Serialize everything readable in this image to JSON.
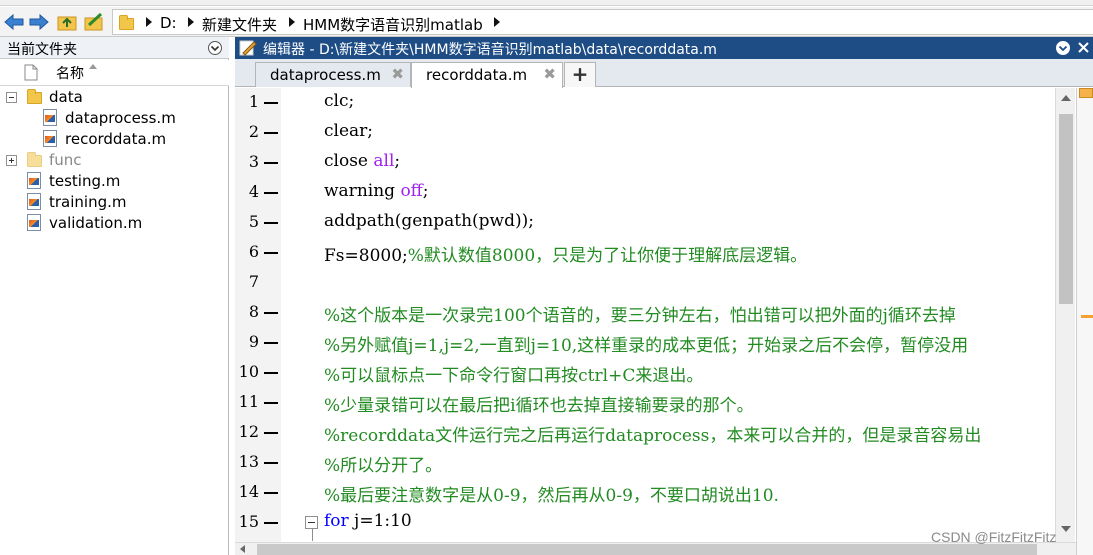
{
  "nav": {
    "back_icon": "arrow-left-icon",
    "forward_icon": "arrow-right-icon",
    "up_icon": "folder-up-icon",
    "browse_icon": "browse-folder-icon"
  },
  "address": {
    "crumbs": [
      "D:",
      "新建文件夹",
      "HMM数字语音识别matlab"
    ]
  },
  "left_panel": {
    "title": "当前文件夹",
    "column_name": "名称",
    "tree": [
      {
        "label": "data",
        "type": "folder",
        "expanded": true
      },
      {
        "label": "dataprocess.m",
        "type": "file"
      },
      {
        "label": "recorddata.m",
        "type": "file"
      },
      {
        "label": "func",
        "type": "folder",
        "expanded": false
      },
      {
        "label": "testing.m",
        "type": "file"
      },
      {
        "label": "training.m",
        "type": "file"
      },
      {
        "label": "validation.m",
        "type": "file"
      }
    ]
  },
  "editor": {
    "title": "编辑器 - D:\\新建文件夹\\HMM数字语音识别matlab\\data\\recorddata.m",
    "tabs": [
      {
        "label": "dataprocess.m",
        "active": false
      },
      {
        "label": "recorddata.m",
        "active": true
      }
    ],
    "add_tab_label": "+",
    "lines": [
      {
        "num": "1",
        "parts": [
          [
            "clc;",
            "n"
          ]
        ]
      },
      {
        "num": "2",
        "parts": [
          [
            "clear;",
            "n"
          ]
        ]
      },
      {
        "num": "3",
        "parts": [
          [
            "close ",
            "n"
          ],
          [
            "all",
            "s"
          ],
          [
            ";",
            "n"
          ]
        ]
      },
      {
        "num": "4",
        "parts": [
          [
            "warning ",
            "n"
          ],
          [
            "off",
            "s"
          ],
          [
            ";",
            "n"
          ]
        ]
      },
      {
        "num": "5",
        "parts": [
          [
            "addpath(genpath(pwd));",
            "n"
          ]
        ]
      },
      {
        "num": "6",
        "parts": [
          [
            "Fs=8000;",
            "n"
          ],
          [
            "%默认数值8000，只是为了让你便于理解底层逻辑。",
            "c"
          ]
        ]
      },
      {
        "num": "7",
        "parts": []
      },
      {
        "num": "8",
        "parts": [
          [
            "%这个版本是一次录完100个语音的，要三分钟左右，怕出错可以把外面的j循环去掉",
            "c"
          ]
        ]
      },
      {
        "num": "9",
        "parts": [
          [
            "%另外赋值j=1,j=2,一直到j=10,这样重录的成本更低；开始录之后不会停，暂停没用",
            "c"
          ]
        ]
      },
      {
        "num": "10",
        "parts": [
          [
            "%可以鼠标点一下命令行窗口再按ctrl+C来退出。",
            "c"
          ]
        ]
      },
      {
        "num": "11",
        "parts": [
          [
            "%少量录错可以在最后把i循环也去掉直接输要录的那个。",
            "c"
          ]
        ]
      },
      {
        "num": "12",
        "parts": [
          [
            "%recorddata文件运行完之后再运行dataprocess，本来可以合并的，但是录音容易出",
            "c"
          ]
        ]
      },
      {
        "num": "13",
        "parts": [
          [
            "%所以分开了。",
            "c"
          ]
        ]
      },
      {
        "num": "14",
        "parts": [
          [
            "%最后要注意数字是从0-9，然后再从0-9，不要口胡说出10.",
            "c"
          ]
        ]
      },
      {
        "num": "15",
        "parts": [
          [
            "for",
            "k"
          ],
          [
            " j=1:10",
            "n"
          ]
        ]
      }
    ]
  },
  "colors": {
    "keyword": "#0000ff",
    "string": "#a020f0",
    "comment": "#228b22",
    "title_bar": "#1e4d86"
  },
  "watermark": "CSDN @FitzFitzFitz"
}
